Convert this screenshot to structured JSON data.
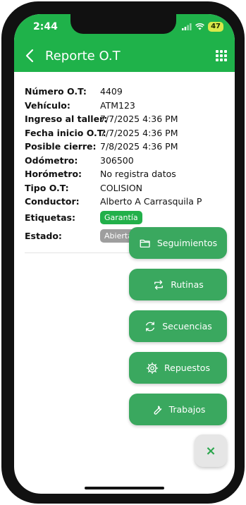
{
  "status_bar": {
    "time": "2:44",
    "battery": "47"
  },
  "header": {
    "title": "Reporte O.T"
  },
  "details": [
    {
      "label": "Número O.T:",
      "value": "4409"
    },
    {
      "label": "Vehículo:",
      "value": "ATM123"
    },
    {
      "label": "Ingreso al taller:",
      "value": "7/7/2025 4:36 PM"
    },
    {
      "label": "Fecha inicio O.T:",
      "value": "7/7/2025 4:36 PM"
    },
    {
      "label": "Posible cierre:",
      "value": "7/8/2025 4:36 PM"
    },
    {
      "label": "Odómetro:",
      "value": "306500"
    },
    {
      "label": "Horómetro:",
      "value": "No registra datos"
    },
    {
      "label": "Tipo O.T:",
      "value": "COLISION"
    },
    {
      "label": "Conductor:",
      "value": "Alberto A Carrasquila P"
    }
  ],
  "tags": {
    "label": "Etiquetas:",
    "items": [
      "Garantía"
    ]
  },
  "estado": {
    "label": "Estado:",
    "value": "Abierta"
  },
  "fab_menu": [
    {
      "label": "Seguimientos",
      "icon": "folder-icon"
    },
    {
      "label": "Rutinas",
      "icon": "repeat-icon"
    },
    {
      "label": "Secuencias",
      "icon": "sync-icon"
    },
    {
      "label": "Repuestos",
      "icon": "gear-icon"
    },
    {
      "label": "Trabajos",
      "icon": "wrench-icon"
    }
  ],
  "fab_close": {
    "label": "×"
  },
  "colors": {
    "header": "#1fb24a",
    "fab": "#3aa85f",
    "tag": "#22b04a",
    "estado_tag": "#9e9e9e"
  }
}
